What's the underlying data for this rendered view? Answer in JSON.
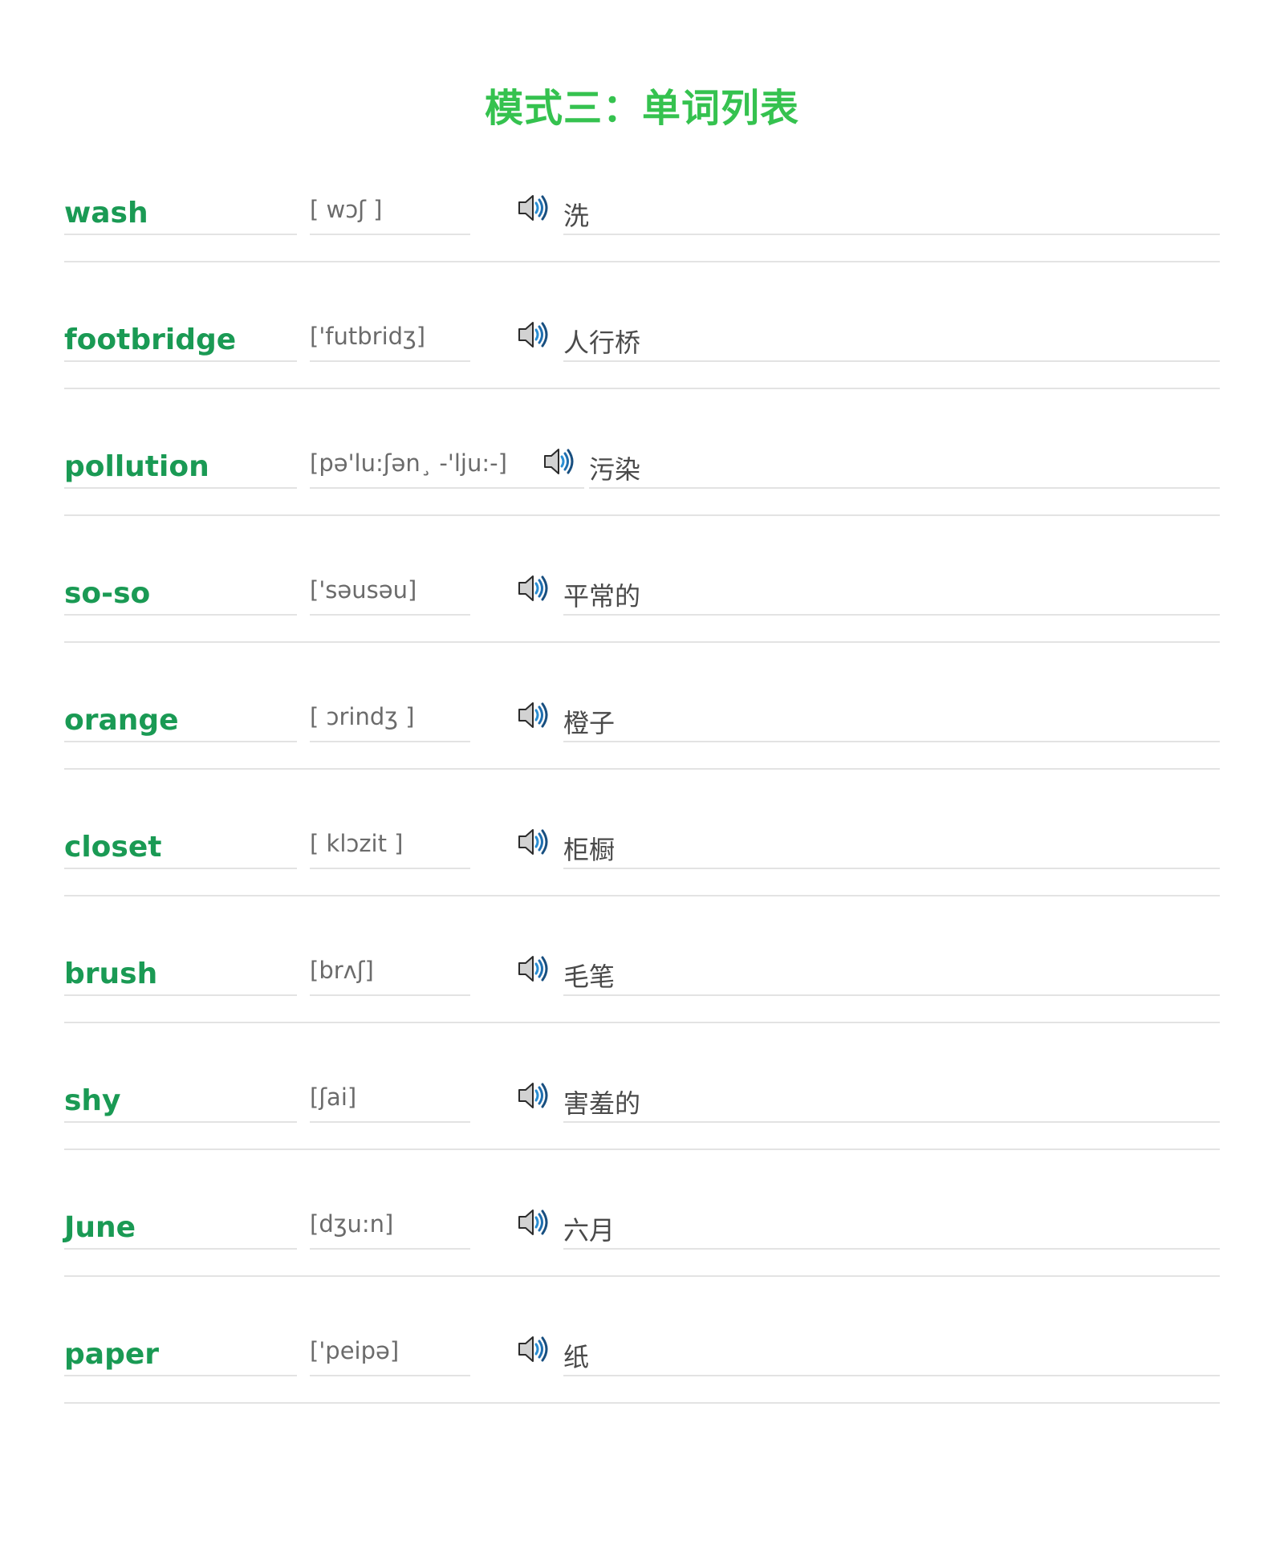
{
  "title": "模式三：单词列表",
  "words": [
    {
      "word": "wash",
      "phonetic": "[ wɔʃ ]",
      "meaning": "洗"
    },
    {
      "word": "footbridge",
      "phonetic": "['futbridʒ]",
      "meaning": "人行桥"
    },
    {
      "word": "pollution",
      "phonetic": "[pə'lu:ʃən¸ -'lju:-]",
      "meaning": "污染"
    },
    {
      "word": "so-so",
      "phonetic": "['səusəu]",
      "meaning": "平常的"
    },
    {
      "word": "orange",
      "phonetic": "[ ɔrindʒ ]",
      "meaning": "橙子"
    },
    {
      "word": "closet",
      "phonetic": "[ klɔzit ]",
      "meaning": "柜橱"
    },
    {
      "word": "brush",
      "phonetic": "[brʌʃ]",
      "meaning": "毛笔"
    },
    {
      "word": "shy",
      "phonetic": "[ʃai]",
      "meaning": "害羞的"
    },
    {
      "word": "June",
      "phonetic": "[dʒu:n]",
      "meaning": "六月"
    },
    {
      "word": "paper",
      "phonetic": "['peipə]",
      "meaning": "纸"
    }
  ],
  "icons": {
    "audio": "speaker-icon"
  },
  "colors": {
    "title": "#35c24f",
    "word": "#1a9a54",
    "rule": "#e3e3e3"
  }
}
